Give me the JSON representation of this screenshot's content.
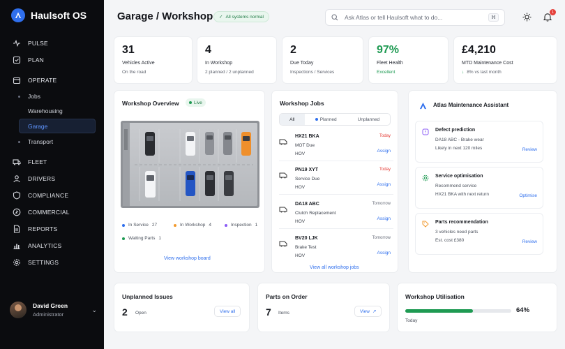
{
  "app": {
    "name": "Haulsoft OS"
  },
  "colors": {
    "accent": "#2f6fed",
    "success": "#1e9a52",
    "danger": "#e5403a",
    "sidebar_bg": "#0b0c0f"
  },
  "sidebar": {
    "items": [
      {
        "label": "PULSE",
        "icon": "pulse-icon"
      },
      {
        "label": "PLAN",
        "icon": "plan-icon"
      },
      {
        "label": "OPERATE",
        "icon": "operate-icon"
      },
      {
        "label": "FLEET",
        "icon": "fleet-icon"
      },
      {
        "label": "DRIVERS",
        "icon": "drivers-icon"
      },
      {
        "label": "COMPLIANCE",
        "icon": "compliance-icon"
      },
      {
        "label": "COMMERCIAL",
        "icon": "commercial-icon"
      },
      {
        "label": "REPORTS",
        "icon": "reports-icon"
      },
      {
        "label": "ANALYTICS",
        "icon": "analytics-icon"
      },
      {
        "label": "SETTINGS",
        "icon": "settings-icon"
      }
    ],
    "operate_sub": [
      {
        "label": "Jobs"
      },
      {
        "label": "Warehousing"
      },
      {
        "label": "Garage",
        "active": true
      },
      {
        "label": "Transport"
      }
    ],
    "user": {
      "name": "David Green",
      "role": "Administrator"
    }
  },
  "header": {
    "title": "Garage / Workshop",
    "status": "All systems normal",
    "search_placeholder": "Ask Atlas or tell Haulsoft what to do...",
    "shortcut": "⌘",
    "notification_count": "1"
  },
  "kpis": [
    {
      "value": "31",
      "label": "Vehicles Active",
      "sub": "On the road"
    },
    {
      "value": "4",
      "label": "In Workshop",
      "sub": "2 planned / 2 unplanned"
    },
    {
      "value": "2",
      "label": "Due Today",
      "sub": "Inspections / Services"
    },
    {
      "value": "97%",
      "label": "Fleet Health",
      "sub": "Excellent"
    },
    {
      "value": "£4,210",
      "label": "MTD Maintenance Cost",
      "sub": "8% vs last month"
    }
  ],
  "workshop_overview": {
    "title": "Workshop Overview",
    "live": "Live",
    "legend": [
      {
        "label": "In Service",
        "count": "27",
        "color": "#2f6fed"
      },
      {
        "label": "In Workshop",
        "count": "4",
        "color": "#f29a2e"
      },
      {
        "label": "Inspection",
        "count": "1",
        "color": "#8b5cf6"
      },
      {
        "label": "Waiting Parts",
        "count": "1",
        "color": "#1e9a52"
      }
    ],
    "link": "View workshop board"
  },
  "workshop_jobs": {
    "title": "Workshop Jobs",
    "tabs": [
      {
        "label": "All"
      },
      {
        "label": "Planned"
      },
      {
        "label": "Unplanned"
      }
    ],
    "jobs": [
      {
        "reg": "HX21 BKA",
        "desc": "MOT Due",
        "site": "HOV",
        "when": "Today",
        "action": "Assign"
      },
      {
        "reg": "PN19 XYT",
        "desc": "Service Due",
        "site": "HOV",
        "when": "Today",
        "action": "Assign"
      },
      {
        "reg": "DA18 ABC",
        "desc": "Clutch Replacement",
        "site": "HOV",
        "when": "Tomorrow",
        "action": "Assign"
      },
      {
        "reg": "BV20 LJK",
        "desc": "Brake Test",
        "site": "HOV",
        "when": "Tomorrow",
        "action": "Assign"
      }
    ],
    "link": "View all workshop jobs"
  },
  "assistant": {
    "title": "Atlas Maintenance Assistant",
    "insights": [
      {
        "title": "Defect prediction",
        "l1": "DA18 ABC - Brake wear",
        "l2": "Likely in next 120 miles",
        "action": "Review"
      },
      {
        "title": "Service optimisation",
        "l1": "Recommend service",
        "l2": "HX21 BKA with next return",
        "action": "Optimise"
      },
      {
        "title": "Parts recommendation",
        "l1": "3 vehicles need parts",
        "l2": "Est. cost £380",
        "action": "Review"
      }
    ]
  },
  "unplanned": {
    "title": "Unplanned Issues",
    "value": "2",
    "label": "Open",
    "action": "View all"
  },
  "parts": {
    "title": "Parts on Order",
    "value": "7",
    "label": "Items",
    "action": "View"
  },
  "utilisation": {
    "title": "Workshop Utilisation",
    "value": "64%",
    "progress": 0.64,
    "label": "Today"
  }
}
